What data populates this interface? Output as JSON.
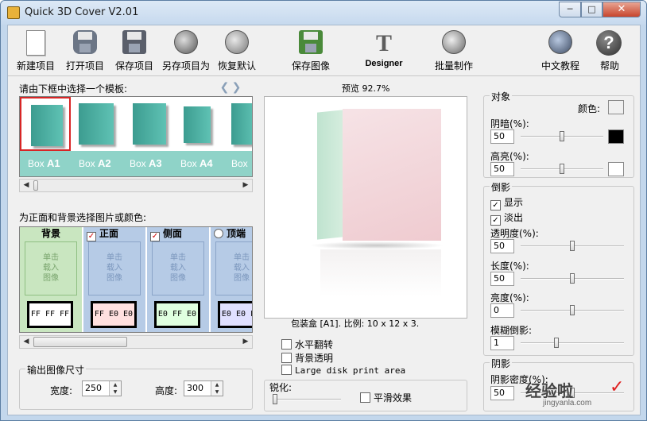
{
  "window": {
    "title": "Quick 3D Cover V2.01",
    "min": "─",
    "max": "□",
    "close": "✕"
  },
  "toolbar": [
    {
      "label": "新建项目",
      "icon": "new-document-icon"
    },
    {
      "label": "打开项目",
      "icon": "open-project-icon"
    },
    {
      "label": "保存项目",
      "icon": "save-disk-icon"
    },
    {
      "label": "另存项目为",
      "icon": "save-as-icon"
    },
    {
      "label": "恢复默认",
      "icon": "restore-default-icon"
    },
    {
      "label": "保存图像",
      "icon": "save-image-icon"
    },
    {
      "label": "Designer",
      "icon": "designer-icon",
      "glyph": "T"
    },
    {
      "label": "批量制作",
      "icon": "batch-icon"
    },
    {
      "label": "中文教程",
      "icon": "tutorial-icon"
    },
    {
      "label": "帮助",
      "icon": "help-icon",
      "glyph": "?"
    }
  ],
  "templates": {
    "title": "请由下框中选择一个模板:",
    "prev": "❮",
    "next": "❯",
    "items": [
      {
        "prefix": "Box ",
        "code": "A1",
        "selected": true
      },
      {
        "prefix": "Box ",
        "code": "A2"
      },
      {
        "prefix": "Box ",
        "code": "A3"
      },
      {
        "prefix": "Box ",
        "code": "A4"
      },
      {
        "prefix": "Box",
        "code": ""
      }
    ]
  },
  "faces": {
    "title": "为正面和背景选择图片或颜色:",
    "load_text": [
      "单击",
      "载入",
      "图像"
    ],
    "items": [
      {
        "name": "背景",
        "color_code": "FF FF FF",
        "color": "#ffffff",
        "bg": "#c9e6c0",
        "mark": ""
      },
      {
        "name": "正面",
        "color_code": "FF E0 E0",
        "color": "#ffe0e0",
        "bg": "#b6cbe6",
        "mark": "✓"
      },
      {
        "name": "侧面",
        "color_code": "E0 FF E0",
        "color": "#e0ffe0",
        "bg": "#b6cbe6",
        "mark": "✓"
      },
      {
        "name": "顶端",
        "color_code": "E0 E0 FF",
        "color": "#e0e0ff",
        "bg": "#b6cbe6",
        "mark": "radio"
      }
    ]
  },
  "output_size": {
    "title": "输出图像尺寸",
    "width_label": "宽度:",
    "width": "250",
    "height_label": "高度:",
    "height": "300"
  },
  "preview": {
    "title": "预览 92.7%",
    "caption": "包装盒 [A1]. 比例: 10 x 12 x 3."
  },
  "options": {
    "flip": "水平翻转",
    "transparent": "背景透明",
    "large_print": "Large disk print area"
  },
  "sharpen": {
    "title": "锐化:",
    "smooth": "平滑效果"
  },
  "object": {
    "title": "对象",
    "color_label": "颜色:",
    "shade_label": "阴暗(%):",
    "shade_value": "50",
    "shade_color": "#000000",
    "highlight_label": "高亮(%):",
    "highlight_value": "50",
    "highlight_color": "#ffffff",
    "object_color": "#f0f0f0"
  },
  "reflection": {
    "title": "倒影",
    "show_label": "显示",
    "show": true,
    "fade_label": "淡出",
    "fade": true,
    "transparency_label": "透明度(%):",
    "transparency_value": "50",
    "length_label": "长度(%):",
    "length_value": "50",
    "brightness_label": "亮度(%):",
    "brightness_value": "0",
    "blur_label": "模糊倒影:",
    "blur_value": "1"
  },
  "shadow": {
    "title": "阴影",
    "density_label": "阴影密度(%):",
    "density_value": "50"
  },
  "watermark": {
    "text": "经验啦",
    "sub": "jingyanla.com",
    "check": "✓"
  }
}
